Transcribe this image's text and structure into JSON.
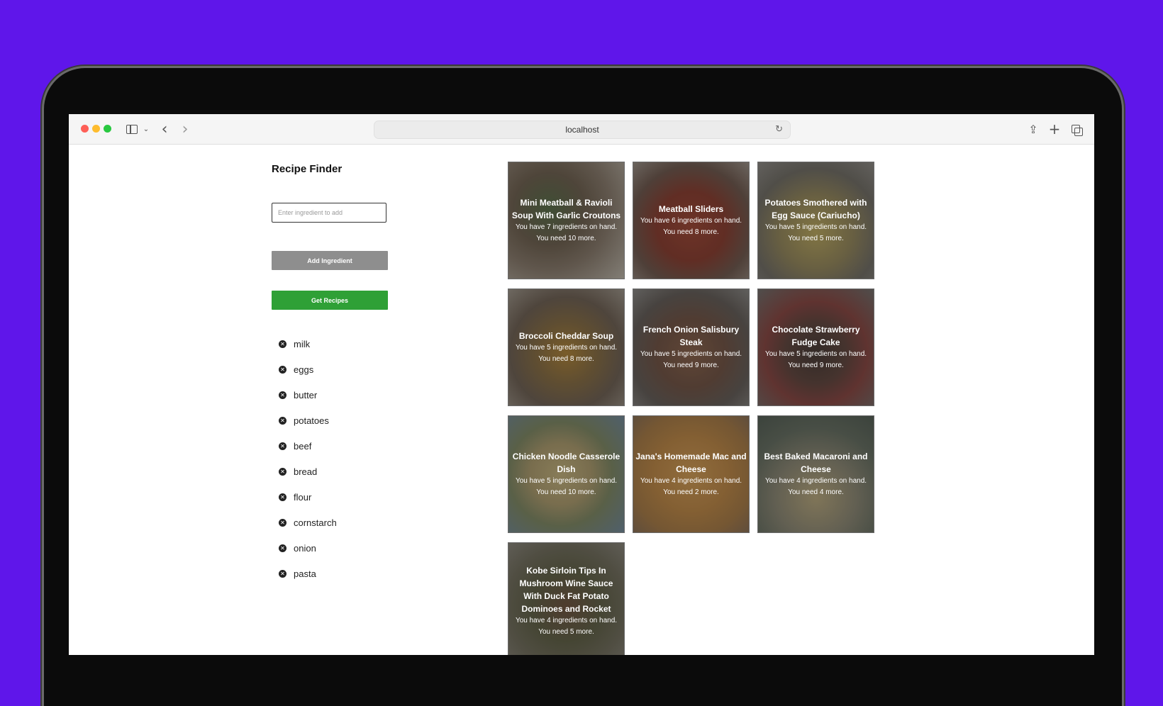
{
  "browser": {
    "url": "localhost"
  },
  "app": {
    "title": "Recipe Finder",
    "input_placeholder": "Enter ingredient to add",
    "add_button": "Add Ingredient",
    "get_button": "Get Recipes",
    "colors": {
      "add_button": "#8e8e8e",
      "get_button": "#2fa036",
      "backdrop": "#5f16ea"
    }
  },
  "ingredients": [
    "milk",
    "eggs",
    "butter",
    "potatoes",
    "beef",
    "bread",
    "flour",
    "cornstarch",
    "onion",
    "pasta"
  ],
  "recipes": [
    {
      "title": "Mini Meatball & Ravioli Soup With Garlic Croutons",
      "have": "You have 7 ingredients on hand.",
      "need": "You need 10 more."
    },
    {
      "title": "Meatball Sliders",
      "have": "You have 6 ingredients on hand.",
      "need": "You need 8 more."
    },
    {
      "title": "Potatoes Smothered with Egg Sauce (Cariucho)",
      "have": "You have 5 ingredients on hand.",
      "need": "You need 5 more."
    },
    {
      "title": "Broccoli Cheddar Soup",
      "have": "You have 5 ingredients on hand.",
      "need": "You need 8 more."
    },
    {
      "title": "French Onion Salisbury Steak",
      "have": "You have 5 ingredients on hand.",
      "need": "You need 9 more."
    },
    {
      "title": "Chocolate Strawberry Fudge Cake",
      "have": "You have 5 ingredients on hand.",
      "need": "You need 9 more."
    },
    {
      "title": "Chicken Noodle Casserole Dish",
      "have": "You have 5 ingredients on hand.",
      "need": "You need 10 more."
    },
    {
      "title": "Jana's Homemade Mac and Cheese",
      "have": "You have 4 ingredients on hand.",
      "need": "You need 2 more."
    },
    {
      "title": "Best Baked Macaroni and Cheese",
      "have": "You have 4 ingredients on hand.",
      "need": "You need 4 more."
    },
    {
      "title": "Kobe Sirloin Tips In Mushroom Wine Sauce With Duck Fat Potato Dominoes and Rocket",
      "have": "You have 4 ingredients on hand.",
      "need": "You need 5 more."
    }
  ]
}
